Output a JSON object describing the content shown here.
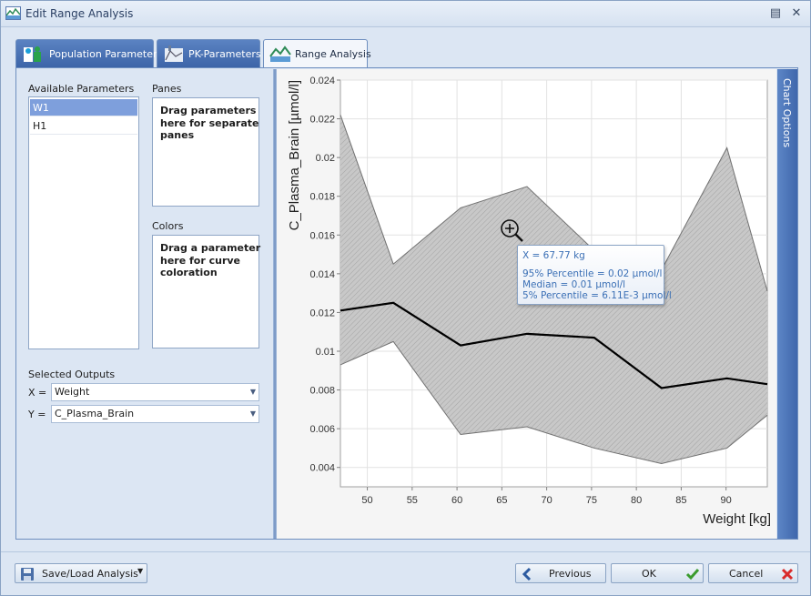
{
  "window": {
    "title": "Edit Range Analysis"
  },
  "tabs": [
    {
      "label": "Population Parameters"
    },
    {
      "label": "PK-Parameters"
    },
    {
      "label": "Range Analysis"
    }
  ],
  "left": {
    "available_label": "Available Parameters",
    "available_items": [
      "W1",
      "H1"
    ],
    "panes_label": "Panes",
    "panes_hint": "Drag parameters here for separate panes",
    "colors_label": "Colors",
    "colors_hint": "Drag a parameter here for curve coloration",
    "selected_outputs_label": "Selected Outputs",
    "x_label": "X =",
    "x_value": "Weight",
    "y_label": "Y =",
    "y_value": "C_Plasma_Brain"
  },
  "chart_options_label": "Chart Options",
  "tooltip": {
    "x": "X = 67.77 kg",
    "p95": "95% Percentile = 0.02 µmol/l",
    "median": "Median = 0.01 µmol/l",
    "p5": "5% Percentile = 6.11E-3 µmol/l"
  },
  "buttons": {
    "save_load": "Save/Load Analysis",
    "previous": "Previous",
    "ok": "OK",
    "cancel": "Cancel"
  },
  "colors": {
    "tab_blue": "#4a73b6",
    "band_fill": "#c8c8c8",
    "median_line": "#000000",
    "tooltip_text": "#3a6fb5"
  },
  "chart_data": {
    "type": "area",
    "xlabel": "Weight [kg]",
    "ylabel": "C_Plasma_Brain [µmol/l]",
    "xlim": [
      47,
      94.6
    ],
    "ylim": [
      0.003,
      0.024
    ],
    "x_ticks": [
      "50",
      "55",
      "60",
      "65",
      "70",
      "75",
      "80",
      "85",
      "90"
    ],
    "y_ticks": [
      "0.004",
      "0.006",
      "0.008",
      "0.01",
      "0.012",
      "0.014",
      "0.016",
      "0.018",
      "0.02",
      "0.022",
      "0.024"
    ],
    "grid": true,
    "x": [
      47,
      52.9,
      60.4,
      67.8,
      75.3,
      82.8,
      90.1,
      94.6
    ],
    "series": [
      {
        "values": [
          0.0222,
          0.0145,
          0.0174,
          0.0185,
          0.0152,
          0.0142,
          0.0205,
          0.0131
        ]
      },
      {
        "values": [
          0.0121,
          0.0125,
          0.0103,
          0.0109,
          0.0107,
          0.0081,
          0.0086,
          0.0083
        ]
      },
      {
        "values": [
          0.0093,
          0.0105,
          0.0057,
          0.0061,
          0.005,
          0.0042,
          0.005,
          0.0067
        ]
      }
    ]
  }
}
